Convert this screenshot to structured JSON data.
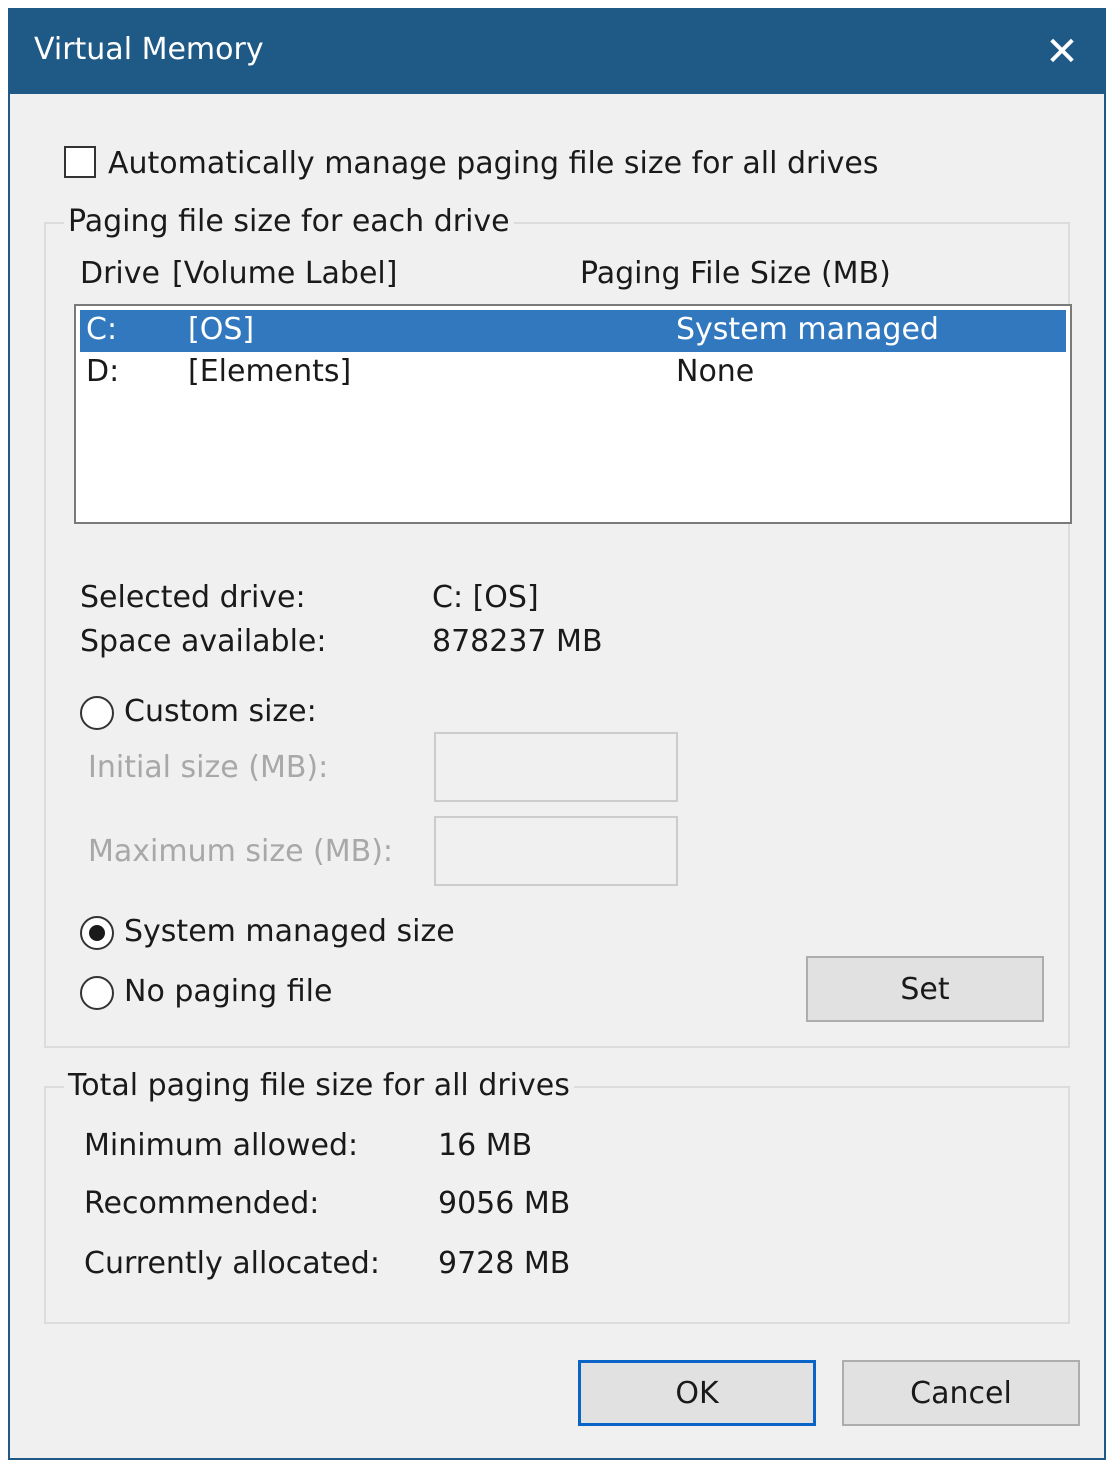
{
  "window": {
    "title": "Virtual Memory",
    "close_symbol": "✕"
  },
  "auto_manage": {
    "label": "Automatically manage paging file size for all drives",
    "checked": false
  },
  "paging_group": {
    "title": "Paging file size for each drive",
    "columns": {
      "drive": "Drive",
      "volume_label": "[Volume Label]",
      "size": "Paging File Size (MB)"
    },
    "drives": [
      {
        "drive": "C:",
        "label": "[OS]",
        "size": "System managed",
        "selected": true
      },
      {
        "drive": "D:",
        "label": "[Elements]",
        "size": "None",
        "selected": false
      }
    ],
    "selected_drive_label": "Selected drive:",
    "selected_drive_value": "C:  [OS]",
    "space_available_label": "Space available:",
    "space_available_value": "878237 MB",
    "custom_size_label": "Custom size:",
    "initial_size_label": "Initial size (MB):",
    "initial_size_value": "",
    "maximum_size_label": "Maximum size (MB):",
    "maximum_size_value": "",
    "system_managed_label": "System managed size",
    "no_paging_label": "No paging file",
    "selected_option": "system_managed",
    "set_button": "Set"
  },
  "total_group": {
    "title": "Total paging file size for all drives",
    "minimum_label": "Minimum allowed:",
    "minimum_value": "16 MB",
    "recommended_label": "Recommended:",
    "recommended_value": "9056 MB",
    "allocated_label": "Currently allocated:",
    "allocated_value": "9728 MB"
  },
  "buttons": {
    "ok": "OK",
    "cancel": "Cancel"
  },
  "colors": {
    "titlebar": "#1f5a87",
    "selection": "#3278be",
    "default_button_border": "#0a64c8"
  },
  "icons": {
    "close": "close-icon",
    "checkbox": "checkbox-unchecked",
    "radio_selected": "radio-selected",
    "radio_unselected": "radio-unselected"
  }
}
